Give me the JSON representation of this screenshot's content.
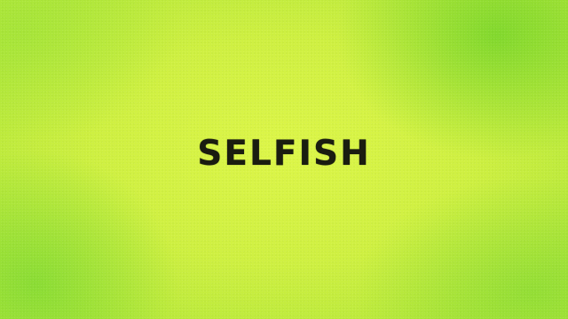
{
  "title": "SELFISH",
  "colors": {
    "background": "#cff041",
    "text": "#1a1c10"
  }
}
